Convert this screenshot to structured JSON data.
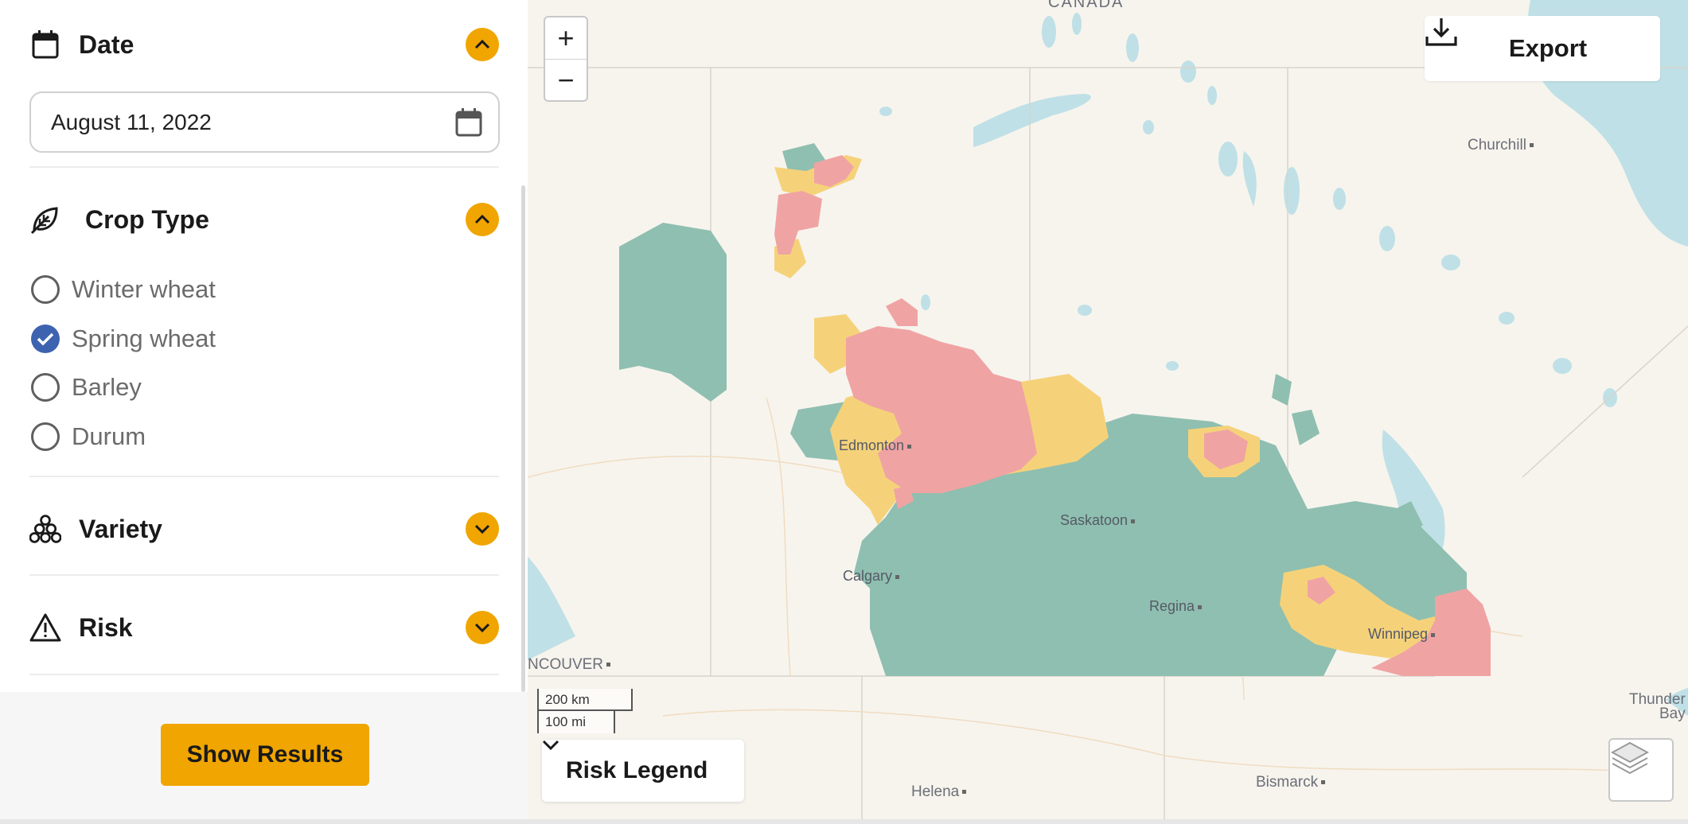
{
  "sidebar": {
    "date_section": {
      "title": "Date",
      "value": "August 11, 2022"
    },
    "crop_section": {
      "title": "Crop Type",
      "options": [
        {
          "label": "Winter wheat",
          "checked": false
        },
        {
          "label": "Spring wheat",
          "checked": true
        },
        {
          "label": "Barley",
          "checked": false
        },
        {
          "label": "Durum",
          "checked": false
        }
      ]
    },
    "variety_section": {
      "title": "Variety"
    },
    "risk_section": {
      "title": "Risk"
    },
    "show_results_label": "Show Results"
  },
  "map": {
    "export_label": "Export",
    "zoom_in": "+",
    "zoom_out": "−",
    "legend_label": "Risk Legend",
    "scale_km": "200 km",
    "scale_mi": "100 mi",
    "labels": {
      "canada": "CANADA",
      "churchill": "Churchill",
      "edmonton": "Edmonton",
      "saskatoon": "Saskatoon",
      "calgary": "Calgary",
      "regina": "Regina",
      "winnipeg": "Winnipeg",
      "vancouver": "NCOUVER",
      "helena": "Helena",
      "bismarck": "Bismarck",
      "thunder_bay_1": "Thunder",
      "thunder_bay_2": "Bay"
    },
    "risk_colors": {
      "low": "#8fbfb0",
      "medium": "#f5d27a",
      "high": "#f0a3a3"
    }
  },
  "colors": {
    "accent": "#f0a500",
    "checked": "#3d63b0"
  }
}
